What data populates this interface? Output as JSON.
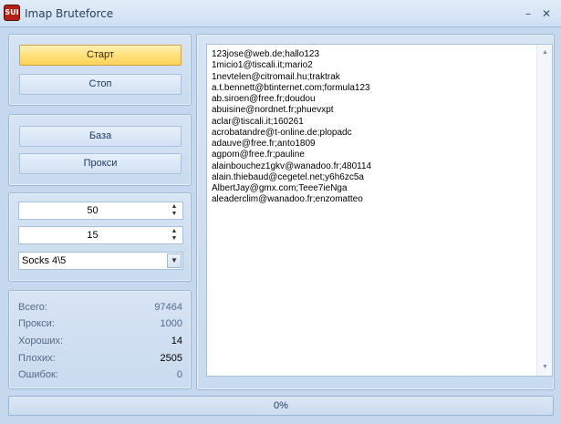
{
  "window": {
    "icon_text": "SUI",
    "title": "Imap Bruteforce",
    "minimize_glyph": "–",
    "close_glyph": "✕"
  },
  "controls": {
    "start_label": "Старт",
    "stop_label": "Стоп",
    "base_label": "База",
    "proxy_label": "Прокси"
  },
  "settings": {
    "threads": "50",
    "timeout": "15",
    "proxy_type": "Socks 4\\5"
  },
  "stats": [
    {
      "label": "Всего:",
      "value": "97464",
      "emphasis": false
    },
    {
      "label": "Прокси:",
      "value": "1000",
      "emphasis": false
    },
    {
      "label": "Хороших:",
      "value": "14",
      "emphasis": true
    },
    {
      "label": "Плохих:",
      "value": "2505",
      "emphasis": true
    },
    {
      "label": "Ошибок:",
      "value": "0",
      "emphasis": false
    }
  ],
  "log_lines": [
    "123jose@web.de;hallo123",
    "1micio1@tiscali.it;mario2",
    "1nevtelen@citromail.hu;traktrak",
    "a.t.bennett@btinternet.com;formula123",
    "ab.siroen@free.fr;doudou",
    "abuisine@nordnet.fr;phuevxpt",
    "aclar@tiscali.it;160261",
    "acrobatandre@t-online.de;plopadc",
    "adauve@free.fr;anto1809",
    "agpom@free.fr;pauline",
    "alainbouchez1gkv@wanadoo.fr;480114",
    "alain.thiebaud@cegetel.net;y6h6zc5a",
    "AlbertJay@gmx.com;Teee7ieNga",
    "aleaderclim@wanadoo.fr;enzomatteo"
  ],
  "progress": {
    "fraction": 0,
    "label": "0%"
  },
  "colors": {
    "accent_active_button": "#ffe07a",
    "window_background": "#c6d8ee"
  }
}
